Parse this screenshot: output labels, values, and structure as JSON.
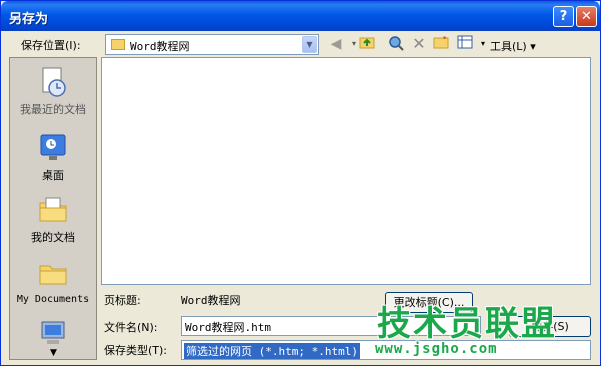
{
  "window": {
    "title": "另存为",
    "help": "?",
    "close": "✕"
  },
  "toolbar": {
    "save_in_label": "保存位置(I):",
    "location": "Word教程网",
    "tools_label": "工具(L)",
    "tools_arrow": "▾",
    "icons": [
      "back-icon",
      "up-folder-icon",
      "search-web-icon",
      "delete-icon",
      "new-folder-icon",
      "views-icon"
    ]
  },
  "places": [
    {
      "label": "我最近的文档"
    },
    {
      "label": "桌面"
    },
    {
      "label": "我的文档"
    },
    {
      "label": "My Documents"
    },
    {
      "label": ""
    }
  ],
  "form": {
    "page_title_label": "页标题:",
    "page_title_value": "Word教程网",
    "change_title_button": "更改标题(C)...",
    "filename_label": "文件名(N):",
    "filename_value": "Word教程网.htm",
    "save_button": "保存(S)",
    "filetype_label": "保存类型(T):",
    "filetype_value": "筛选过的网页 (*.htm; *.html)"
  },
  "watermark": {
    "line1": "技术员联盟",
    "line2": "www.jsgho.com"
  }
}
